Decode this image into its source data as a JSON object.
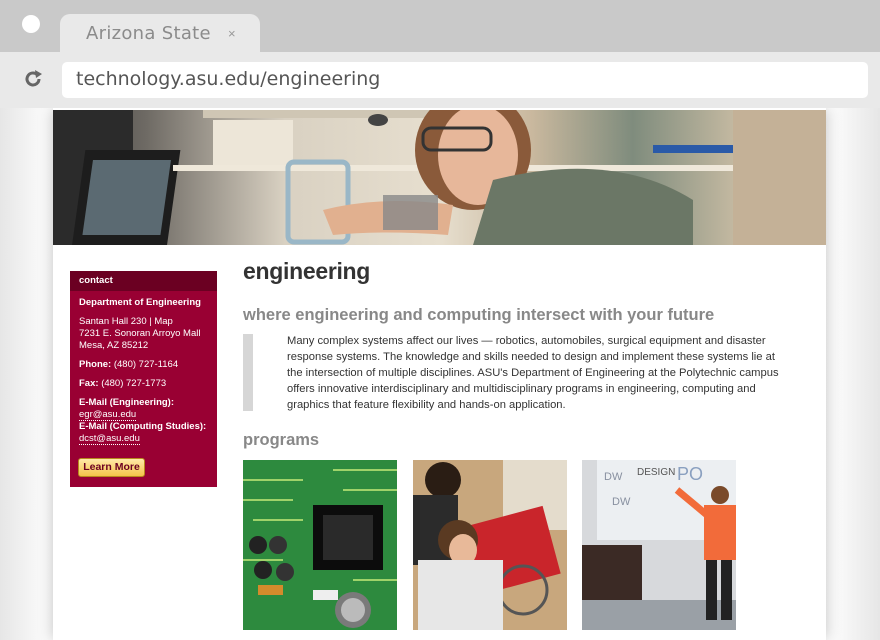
{
  "browser": {
    "tab_title": "Arizona State",
    "tab_close": "×",
    "url": "technology.asu.edu/engineering"
  },
  "sidebar": {
    "heading": "contact",
    "dept": "Department of Engineering",
    "address_line1": "Santan Hall 230 | Map",
    "address_line2": "7231 E. Sonoran Arroyo Mall",
    "address_line3": "Mesa, AZ 85212",
    "phone_label": "Phone:",
    "phone": "(480) 727-1164",
    "fax_label": "Fax:",
    "fax": "(480) 727-1773",
    "email_eng_label": "E-Mail (Engineering):",
    "email_eng": "egr@asu.edu",
    "email_cs_label": "E-Mail (Computing Studies):",
    "email_cs": "dcst@asu.edu",
    "learn_more": "Learn More"
  },
  "main": {
    "title": "engineering",
    "subtitle": "where engineering and computing intersect with your future",
    "intro": "Many complex systems affect our lives — robotics, automobiles, surgical equipment and disaster response systems. The knowledge and skills needed to design and implement these systems lie at the intersection of multiple disciplines. ASU's Department of Engineering at the Polytechnic campus offers innovative interdisciplinary and multidisciplinary programs in engineering, computing and graphics that feature flexibility and hands-on application.",
    "programs_heading": "programs"
  },
  "colors": {
    "asu_maroon": "#990033",
    "asu_gold": "#f4c24a"
  }
}
